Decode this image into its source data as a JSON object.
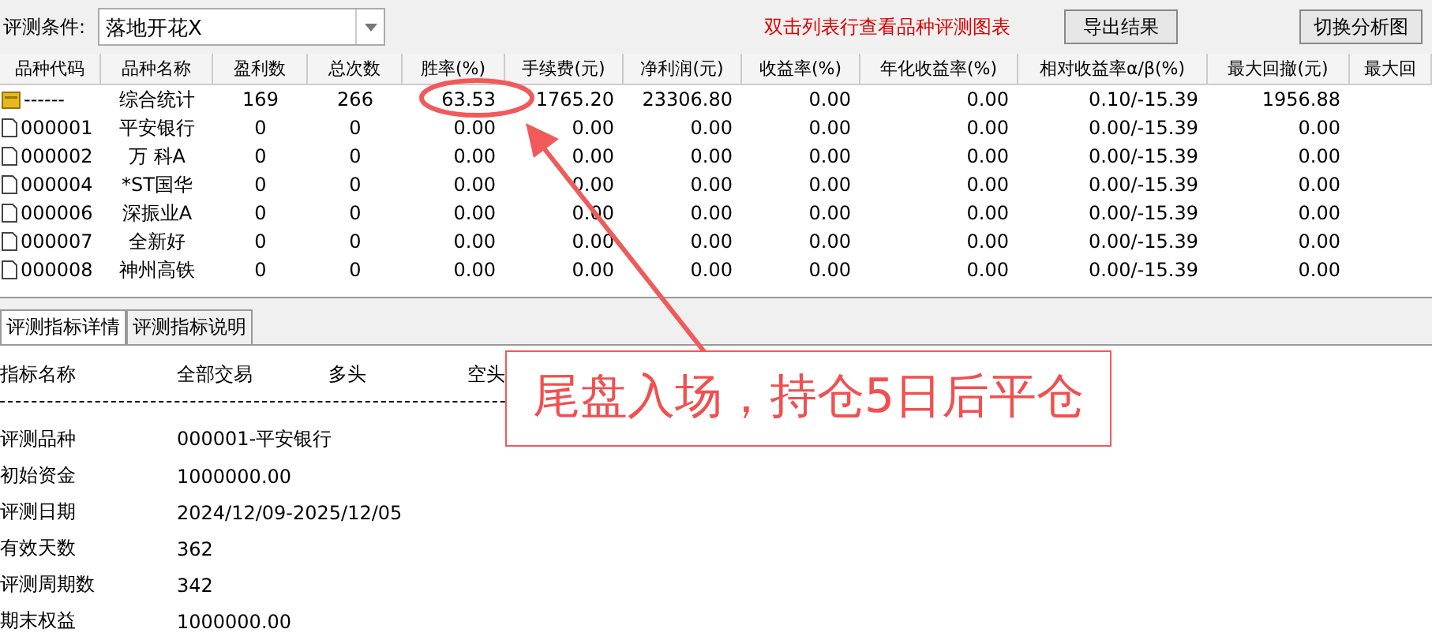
{
  "toolbar": {
    "condition_label": "评测条件:",
    "condition_value": "落地开花X",
    "hint": "双击列表行查看品种评测图表",
    "buttons": [
      "导出结果",
      "切换分析图"
    ]
  },
  "table": {
    "columns": [
      "品种代码",
      "品种名称",
      "盈利数",
      "总次数",
      "胜率(%)",
      "手续费(元)",
      "净利润(元)",
      "收益率(%)",
      "年化收益率(%)",
      "相对收益率α/β(%)",
      "最大回撤(元)",
      "最大回"
    ],
    "rows": [
      {
        "kind": "summary",
        "cells": [
          "------",
          "综合统计",
          "169",
          "266",
          "63.53",
          "1765.20",
          "23306.80",
          "0.00",
          "0.00",
          "0.10/-15.39",
          "1956.88"
        ]
      },
      {
        "kind": "stock",
        "cells": [
          "000001",
          "平安银行",
          "0",
          "0",
          "0.00",
          "0.00",
          "0.00",
          "0.00",
          "0.00",
          "0.00/-15.39",
          "0.00"
        ]
      },
      {
        "kind": "stock",
        "cells": [
          "000002",
          "万 科A",
          "0",
          "0",
          "0.00",
          "0.00",
          "0.00",
          "0.00",
          "0.00",
          "0.00/-15.39",
          "0.00"
        ]
      },
      {
        "kind": "stock",
        "cells": [
          "000004",
          "*ST国华",
          "0",
          "0",
          "0.00",
          "0.00",
          "0.00",
          "0.00",
          "0.00",
          "0.00/-15.39",
          "0.00"
        ]
      },
      {
        "kind": "stock",
        "cells": [
          "000006",
          "深振业A",
          "0",
          "0",
          "0.00",
          "0.00",
          "0.00",
          "0.00",
          "0.00",
          "0.00/-15.39",
          "0.00"
        ]
      },
      {
        "kind": "stock",
        "cells": [
          "000007",
          "全新好",
          "0",
          "0",
          "0.00",
          "0.00",
          "0.00",
          "0.00",
          "0.00",
          "0.00/-15.39",
          "0.00"
        ]
      },
      {
        "kind": "stock",
        "cells": [
          "000008",
          "神州高铁",
          "0",
          "0",
          "0.00",
          "0.00",
          "0.00",
          "0.00",
          "0.00",
          "0.00/-15.39",
          "0.00"
        ]
      }
    ]
  },
  "tabs": [
    {
      "label": "评测指标详情",
      "selected": true
    },
    {
      "label": "评测指标说明",
      "selected": false
    }
  ],
  "detail": {
    "columns": [
      "指标名称",
      "全部交易",
      "多头",
      "空头"
    ],
    "rows": [
      [
        "评测品种",
        "000001-平安银行"
      ],
      [
        "初始资金",
        "1000000.00"
      ],
      [
        "评测日期",
        "2024/12/09-2025/12/05"
      ],
      [
        "有效天数",
        "362"
      ],
      [
        "评测周期数",
        "342"
      ],
      [
        "期末权益",
        "1000000.00"
      ]
    ]
  },
  "annotation": {
    "text": "尾盘入场，持仓5日后平仓"
  }
}
